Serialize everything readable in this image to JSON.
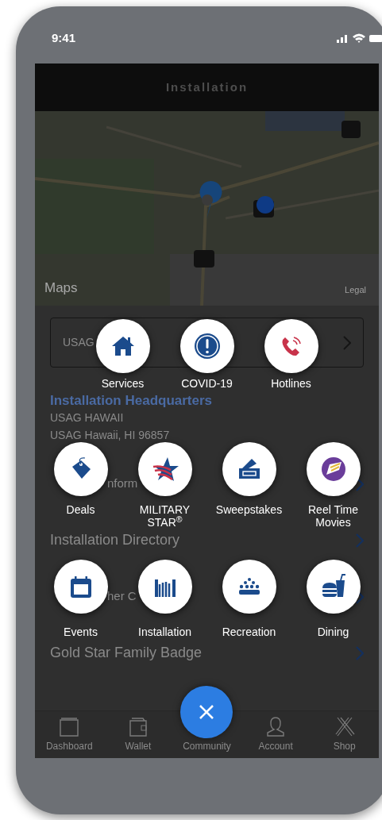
{
  "status_bar": {
    "time": "9:41"
  },
  "header": {
    "title": "Installation"
  },
  "map": {
    "kind": "picture",
    "attribution": "Maps",
    "legal": "Legal"
  },
  "location_card": {
    "value": "USAG"
  },
  "headquarters": {
    "title": "Installation Headquarters",
    "lines": [
      "USAG HAWAII",
      "USAG Hawaii, HI 96857"
    ]
  },
  "links": [
    {
      "text": "nform"
    },
    {
      "text": "Installation Directory"
    },
    {
      "text": "her C"
    },
    {
      "text": "Gold Star Family Badge"
    }
  ],
  "quick_menu": {
    "rows": [
      [
        {
          "label": "Services"
        },
        {
          "label": "COVID-19"
        },
        {
          "label": "Hotlines"
        }
      ],
      [
        {
          "label": "Deals"
        },
        {
          "label": "MILITARY STAR$^{®}$"
        },
        {
          "label": "Sweepstakes"
        },
        {
          "label": "Reel Time Movies"
        }
      ],
      [
        {
          "label": "Events"
        },
        {
          "label": "Installation"
        },
        {
          "label": "Recreation"
        },
        {
          "label": "Dining"
        }
      ]
    ]
  },
  "tab_bar": {
    "items": [
      {
        "label": "Dashboard"
      },
      {
        "label": "Wallet"
      },
      {
        "label": "Community"
      },
      {
        "label": "Account"
      },
      {
        "label": "Shop"
      }
    ]
  }
}
